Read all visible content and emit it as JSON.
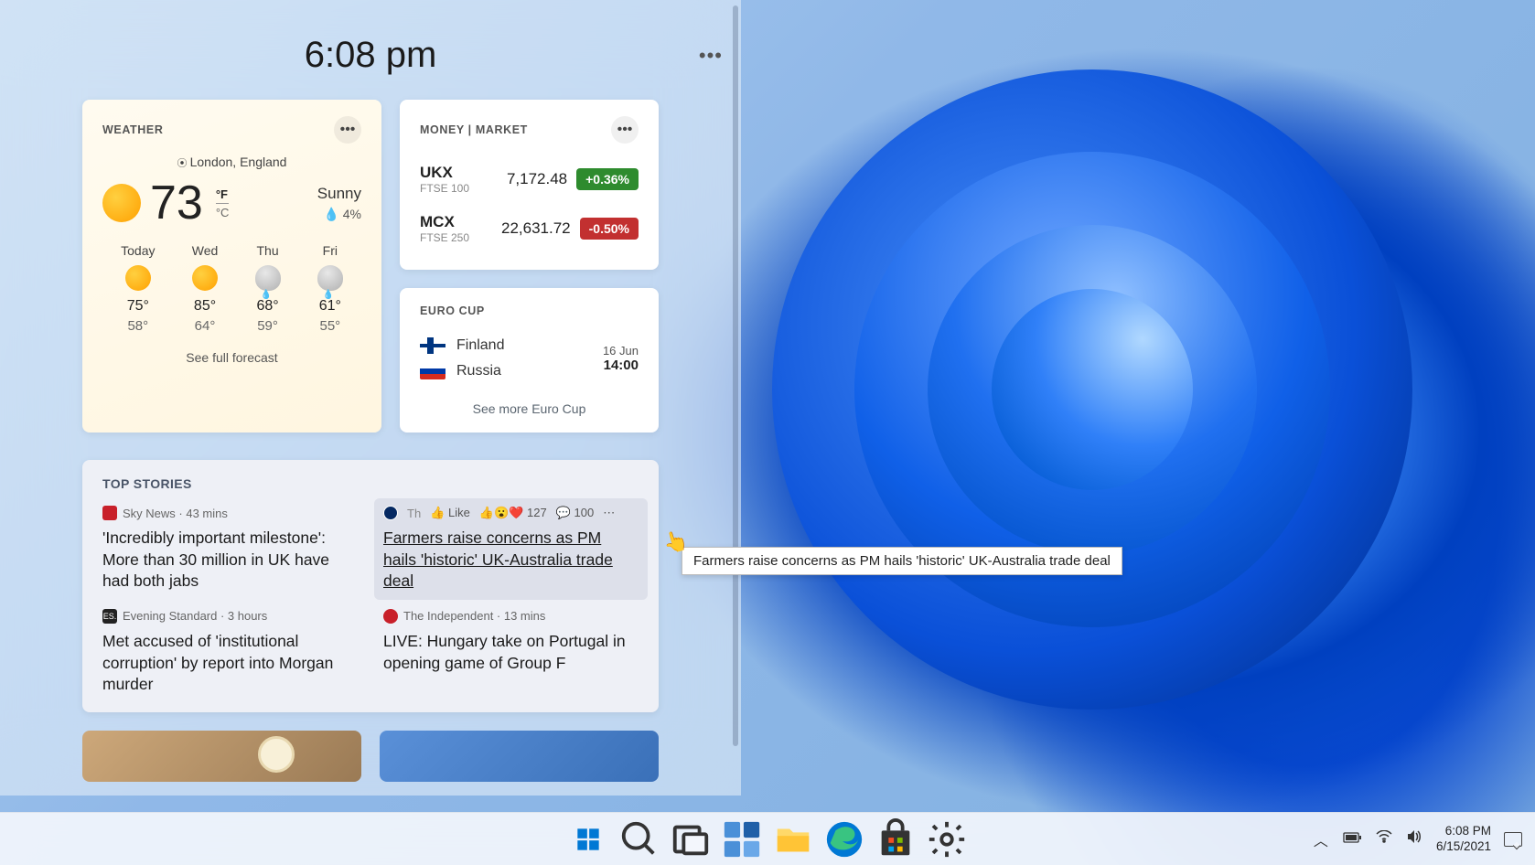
{
  "panel": {
    "time": "6:08 pm",
    "weather": {
      "title": "WEATHER",
      "location": "London, England",
      "temp": "73",
      "unit_f": "°F",
      "unit_c": "°C",
      "condition": "Sunny",
      "precip": "💧 4%",
      "forecast": [
        {
          "day": "Today",
          "hi": "75°",
          "lo": "58°",
          "icon": "sun"
        },
        {
          "day": "Wed",
          "hi": "85°",
          "lo": "64°",
          "icon": "sun"
        },
        {
          "day": "Thu",
          "hi": "68°",
          "lo": "59°",
          "icon": "rain"
        },
        {
          "day": "Fri",
          "hi": "61°",
          "lo": "55°",
          "icon": "rain"
        }
      ],
      "link": "See full forecast"
    },
    "money": {
      "title": "MONEY | MARKET",
      "stocks": [
        {
          "sym": "UKX",
          "sub": "FTSE 100",
          "val": "7,172.48",
          "chg": "+0.36%",
          "dir": "up"
        },
        {
          "sym": "MCX",
          "sub": "FTSE 250",
          "val": "22,631.72",
          "chg": "-0.50%",
          "dir": "dn"
        }
      ]
    },
    "sports": {
      "title": "EURO CUP",
      "team1": "Finland",
      "team2": "Russia",
      "date": "16 Jun",
      "time": "14:00",
      "link": "See more Euro Cup"
    },
    "news": {
      "title": "TOP STORIES",
      "stories": [
        {
          "source": "Sky News",
          "age": "43 mins",
          "headline": "'Incredibly important milestone': More than 30 million in UK have had both jabs"
        },
        {
          "source": "The Guardian",
          "age": "",
          "headline": "Farmers raise concerns as PM hails 'historic' UK-Australia trade deal",
          "like_label": "Like",
          "reactions": "127",
          "comments": "100"
        },
        {
          "source": "Evening Standard",
          "age": "3 hours",
          "headline": "Met accused of 'institutional corruption' by report into Morgan murder"
        },
        {
          "source": "The Independent",
          "age": "13 mins",
          "headline": "LIVE: Hungary take on Portugal in opening game of Group F"
        }
      ]
    }
  },
  "tooltip": "Farmers raise concerns as PM hails 'historic' UK-Australia trade deal",
  "taskbar": {
    "time": "6:08 PM",
    "date": "6/15/2021"
  }
}
